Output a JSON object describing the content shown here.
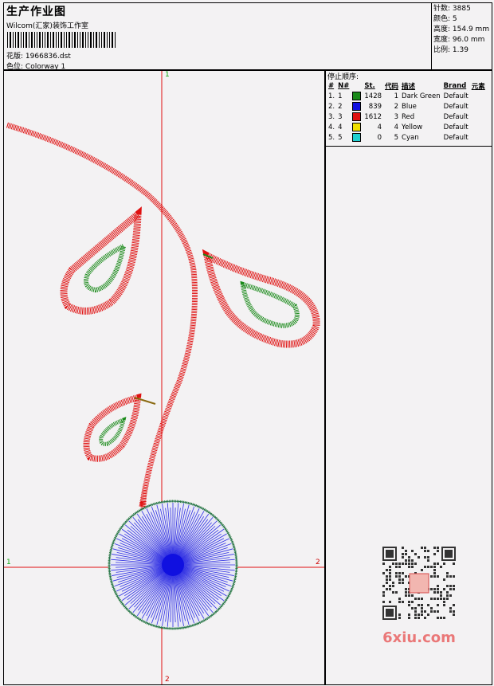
{
  "header": {
    "title": "生产作业图",
    "studio": "Wilcom(汇家)装饰工作室",
    "design_label": "花版:",
    "design_value": "1966836.dst",
    "color_label": "色位:",
    "color_value": "Colorway 1"
  },
  "stats": [
    {
      "label": "针数:",
      "value": "3885"
    },
    {
      "label": "颜色:",
      "value": "5"
    },
    {
      "label": "高度:",
      "value": "154.9 mm"
    },
    {
      "label": "宽度:",
      "value": "96.0 mm"
    },
    {
      "label": "比例:",
      "value": "1.39"
    }
  ],
  "stop_sequence": {
    "title": "停止顺序:",
    "columns": [
      "#",
      "N#",
      "St.",
      "代码",
      "描述",
      "Brand",
      "元素"
    ],
    "rows": [
      {
        "idx": "1.",
        "n": "1",
        "color": "#1a8a1a",
        "st": "1428",
        "code": "1",
        "desc": "Dark Green",
        "brand": "Default"
      },
      {
        "idx": "2.",
        "n": "2",
        "color": "#1010e0",
        "st": "839",
        "code": "2",
        "desc": "Blue",
        "brand": "Default"
      },
      {
        "idx": "3.",
        "n": "3",
        "color": "#e01010",
        "st": "1612",
        "code": "3",
        "desc": "Red",
        "brand": "Default"
      },
      {
        "idx": "4.",
        "n": "4",
        "color": "#f0e000",
        "st": "4",
        "code": "4",
        "desc": "Yellow",
        "brand": "Default"
      },
      {
        "idx": "5.",
        "n": "5",
        "color": "#20d0d0",
        "st": "0",
        "code": "5",
        "desc": "Cyan",
        "brand": "Default"
      }
    ]
  },
  "axes": {
    "top": "1",
    "bottom": "2",
    "left": "1",
    "right": "2"
  },
  "watermark": {
    "text": "6xiu.com"
  }
}
